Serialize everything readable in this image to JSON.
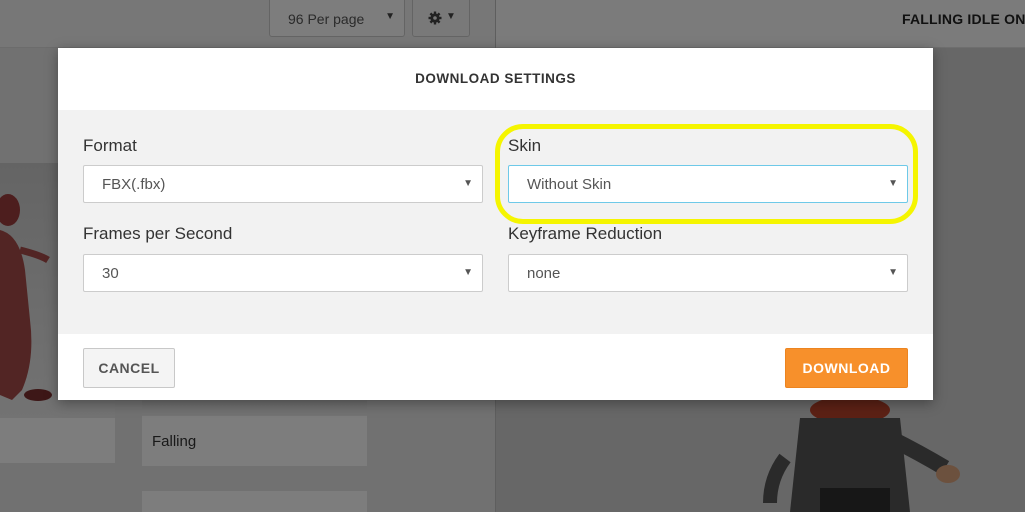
{
  "toolbar": {
    "per_page_label": "96 Per page",
    "settings_icon": "gear-icon"
  },
  "preview": {
    "title": "FALLING IDLE ON"
  },
  "grid": {
    "cards": [
      {
        "label": "Falling"
      }
    ]
  },
  "modal": {
    "title": "DOWNLOAD SETTINGS",
    "fields": {
      "format": {
        "label": "Format",
        "value": "FBX(.fbx)"
      },
      "skin": {
        "label": "Skin",
        "value": "Without Skin"
      },
      "fps": {
        "label": "Frames per Second",
        "value": "30"
      },
      "keyframe_reduction": {
        "label": "Keyframe Reduction",
        "value": "none"
      }
    },
    "cancel_label": "CANCEL",
    "download_label": "DOWNLOAD"
  },
  "colors": {
    "accent": "#f7902b",
    "highlight": "#f5f500",
    "focus_border": "#6ec9e8"
  }
}
